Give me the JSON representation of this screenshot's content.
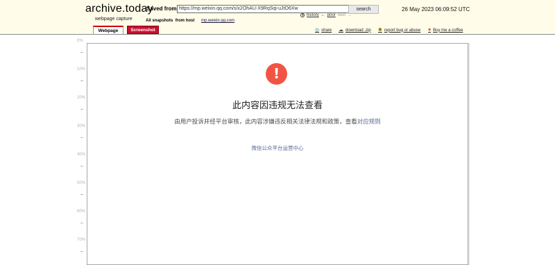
{
  "header": {
    "logo": "archive.today",
    "logo_subtitle": "webpage capture",
    "saved_from_label": "Saved from",
    "url_value": "https://mp.weixin.qq.com/s/x2OhAU-X9RqSqi-uJtO6Xw",
    "search_label": "search",
    "history_label": "history",
    "prior_label": "prior",
    "next_label": "next",
    "datetime": "26 May 2023 06:09:52 UTC",
    "all_snapshots_label": "All snapshots",
    "from_host_label": "from host",
    "host": "mp.weixin.qq.com"
  },
  "tabs": [
    {
      "label": "Webpage",
      "active": true
    },
    {
      "label": "Screenshot",
      "active": false
    }
  ],
  "actions": {
    "share": "share",
    "download": "download .zip",
    "report": "report bug or abuse",
    "coffee": "Buy me a coffee"
  },
  "ruler": {
    "labels": [
      "0%",
      "10%",
      "20%",
      "30%",
      "40%",
      "50%",
      "60%",
      "70%"
    ]
  },
  "page": {
    "warn_glyph": "!",
    "title": "此内容因违规无法查看",
    "body_text": "由用户投诉并经平台审核，此内容涉嫌违反相关法律法规和政策，查看",
    "body_link": "对应规则",
    "footer_link": "微信公众平台运营中心"
  },
  "colors": {
    "header_bg": "#fffde9",
    "tab_screenshot_bg": "#c8102e",
    "warn_red": "#f25444",
    "link_blue": "#576b95"
  }
}
